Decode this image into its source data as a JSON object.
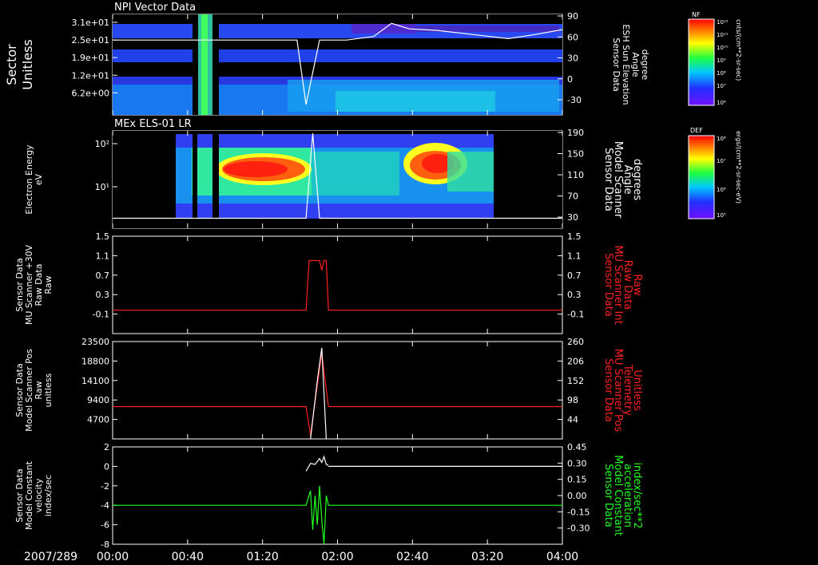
{
  "date_label": "2007/289",
  "time_ticks": [
    "00:00",
    "00:40",
    "01:20",
    "02:00",
    "02:40",
    "03:20",
    "04:00"
  ],
  "colors": {
    "red": "#ff2020",
    "green": "#20ff20",
    "white": "#ffffff",
    "navy": "#1010a0"
  },
  "chart_data": [
    {
      "id": "npi",
      "type": "heatmap",
      "title": "NPI Vector Data",
      "ylabel_left": [
        "Sector",
        "Unitless"
      ],
      "yticks_left": [
        "3.1e+01",
        "2.5e+01",
        "1.9e+01",
        "1.2e+01",
        "6.2e+00"
      ],
      "ylabel_right": [
        "Sensor Data",
        "ESH Sun Elevation",
        "Angle",
        "degree"
      ],
      "yticks_right": [
        "90",
        "60",
        "30",
        "0",
        "-30"
      ],
      "colorbar": {
        "label": "NF",
        "top": "10¹²",
        "ticks": [
          "10¹¹",
          "10¹⁰",
          "10⁹",
          "10⁸",
          "10⁷"
        ],
        "bottom": "10⁶",
        "units": "cnts/(cm**2-sr-sec)"
      },
      "overlay_line": {
        "x": [
          0,
          0.41,
          0.43,
          0.46,
          0.52,
          0.58,
          0.62,
          0.66,
          0.72,
          0.8,
          0.88,
          0.94,
          1.0
        ],
        "y": [
          58,
          58,
          -35,
          58,
          58,
          63,
          82,
          74,
          72,
          66,
          60,
          66,
          73
        ]
      }
    },
    {
      "id": "els",
      "type": "heatmap",
      "title": "MEx ELS-01 LR",
      "ylabel_left": [
        "Electron Energy",
        "eV"
      ],
      "yticks_left": [
        "10²",
        "10¹"
      ],
      "ylabel_right": [
        "Sensor Data",
        "Model Scanner",
        "Angle",
        "degrees"
      ],
      "yticks_right": [
        "190",
        "150",
        "110",
        "70",
        "30"
      ],
      "colorbar": {
        "label": "DEF",
        "top": "10⁸",
        "ticks": [
          "10⁷",
          "10⁶"
        ],
        "bottom": "10⁵",
        "units": "ergs/(cm**2-sr-sec-eV)"
      },
      "overlay_line": {
        "x": [
          0,
          0.43,
          0.445,
          0.46,
          0.47,
          1.0
        ],
        "y": [
          20,
          20,
          190,
          20,
          20,
          20
        ]
      }
    },
    {
      "id": "mu30",
      "type": "line",
      "ylabel_left": [
        "Sensor Data",
        "MU Scanner +30V",
        "Raw Data",
        "Raw"
      ],
      "yticks_left": [
        "1.5",
        "1.1",
        "0.7",
        "0.3",
        "-0.1"
      ],
      "ylim": [
        -0.5,
        1.5
      ],
      "ylabel_right": [
        "Sensor Data",
        "MU Scanner Int",
        "Raw Data",
        "Raw"
      ],
      "yticks_right": [
        "1.5",
        "1.1",
        "0.7",
        "0.3",
        "-0.1"
      ],
      "series": [
        {
          "color": "#ff2020",
          "x": [
            0,
            0.43,
            0.437,
            0.46,
            0.465,
            0.47,
            0.475,
            0.48,
            1.0
          ],
          "y": [
            -0.02,
            -0.02,
            1.0,
            1.0,
            0.8,
            1.0,
            1.0,
            -0.02,
            -0.02
          ]
        }
      ]
    },
    {
      "id": "scanpos",
      "type": "line",
      "ylabel_left": [
        "Sensor Data",
        "Model Scanner Pos",
        "Raw",
        "unitless"
      ],
      "yticks_left": [
        "23500",
        "18800",
        "14100",
        "9400",
        "4700"
      ],
      "ylim": [
        0,
        23500
      ],
      "ylabel_right": [
        "Sensor Data",
        "MU Scanner Pos",
        "Telemetry",
        "Unitless"
      ],
      "yticks_right": [
        "260",
        "206",
        "152",
        "98",
        "44"
      ],
      "series": [
        {
          "color": "#ff2020",
          "x": [
            0,
            0.43,
            0.44,
            0.465,
            0.48,
            1.0
          ],
          "y": [
            7800,
            7800,
            900,
            20700,
            7800,
            7800
          ]
        },
        {
          "color": "#ffffff",
          "x": [
            0.44,
            0.455,
            0.465,
            0.475
          ],
          "y": [
            0,
            14000,
            22000,
            0
          ]
        }
      ]
    },
    {
      "id": "velocity",
      "type": "line",
      "ylabel_left": [
        "Sensor Data",
        "Model Constant",
        "velocity",
        "index/sec"
      ],
      "yticks_left": [
        "2",
        "0",
        "-2",
        "-4",
        "-6",
        "-8"
      ],
      "ylim": [
        -8,
        2
      ],
      "ylabel_right": [
        "Sensor Data",
        "Model Constant",
        "acceleration",
        "index/sec**2"
      ],
      "yticks_right": [
        "0.45",
        "0.30",
        "0.15",
        "0.00",
        "-0.15",
        "-0.30"
      ],
      "series": [
        {
          "color": "#20ff20",
          "x": [
            0,
            0.43,
            0.44,
            0.445,
            0.45,
            0.455,
            0.46,
            0.465,
            0.47,
            0.475,
            0.48,
            1.0
          ],
          "y": [
            -4,
            -4,
            -2.5,
            -6.5,
            -3,
            -6,
            -2,
            -5.5,
            -8,
            -3,
            -4,
            -4
          ]
        },
        {
          "color": "#ffffff",
          "x": [
            0.43,
            0.44,
            0.45,
            0.46,
            0.465,
            0.47,
            0.475,
            0.48
          ],
          "y": [
            -0.5,
            0.3,
            0.2,
            0.8,
            0.4,
            1.0,
            0.2,
            0.1
          ]
        },
        {
          "color": "#ffffff",
          "x": [
            0.48,
            1.0
          ],
          "y": [
            0,
            0
          ]
        }
      ]
    }
  ]
}
